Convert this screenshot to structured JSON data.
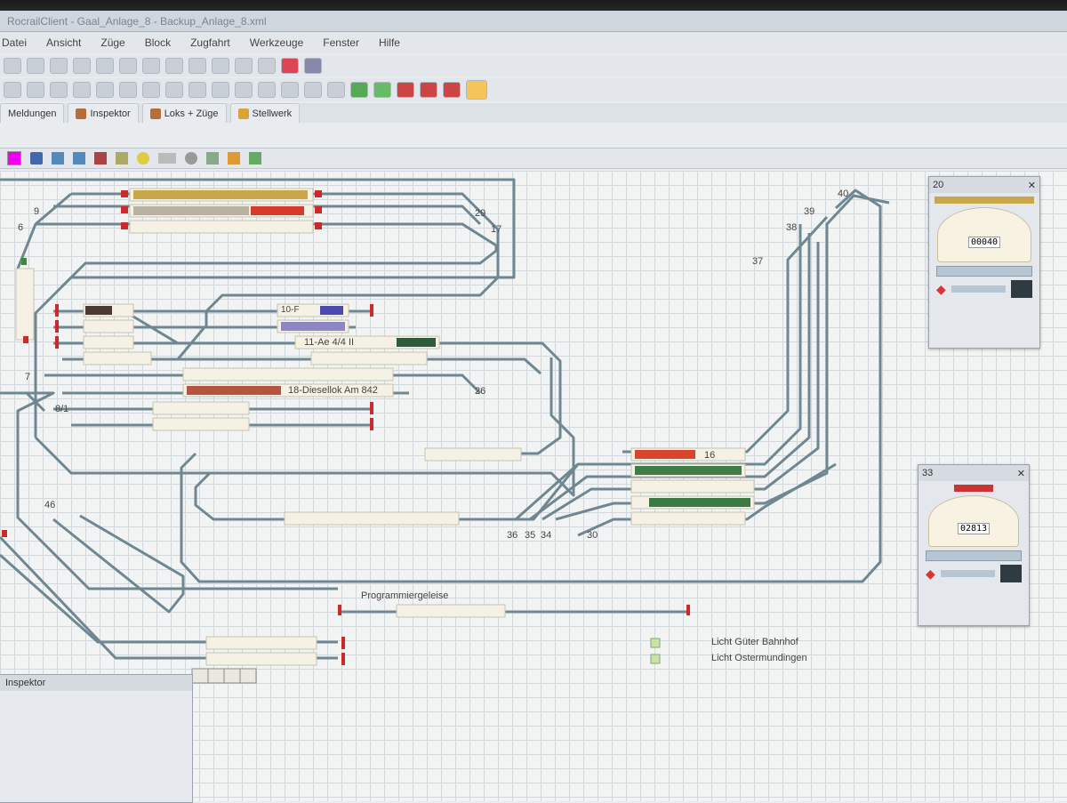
{
  "window": {
    "title": "RocrailClient - Gaal_Anlage_8 - Backup_Anlage_8.xml"
  },
  "menu": [
    "Datei",
    "Ansicht",
    "Züge",
    "Block",
    "Zugfahrt",
    "Werkzeuge",
    "Fenster",
    "Hilfe"
  ],
  "tabs": [
    {
      "label": "Meldungen"
    },
    {
      "label": "Inspektor"
    },
    {
      "label": "Loks + Züge"
    },
    {
      "label": "Stellwerk"
    }
  ],
  "track_labels": {
    "n9": "9",
    "n6": "6",
    "n7": "7",
    "n29": "29",
    "n17": "17",
    "n26": "26",
    "n37": "37",
    "n38": "38",
    "n39": "39",
    "n40": "40",
    "n46": "46",
    "n36": "36",
    "n35": "35",
    "n34": "34",
    "n30": "30",
    "n16": "16",
    "n8": "8/1"
  },
  "blocks": {
    "b10": "10-F",
    "b11": "11-Ae 4/4 II",
    "b18": "18-Diesellok Am 842",
    "prog": "Programmiergeleise"
  },
  "lights": [
    {
      "label": "Licht Güter Bahnhof"
    },
    {
      "label": "Licht Ostermundingen"
    }
  ],
  "throttle1": {
    "id": "20",
    "odometer": "00040"
  },
  "throttle2": {
    "id": "33",
    "odometer": "02813"
  },
  "inspector": {
    "title": "Inspektor"
  },
  "colors": {
    "track": "#6f8791",
    "block": "#f5f1e4",
    "signal_red": "#cc2a2a"
  }
}
